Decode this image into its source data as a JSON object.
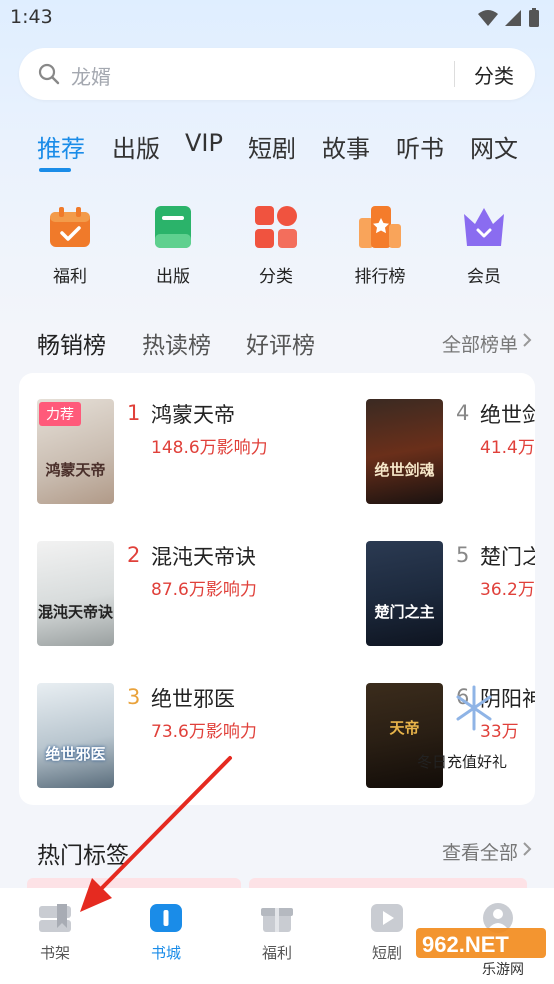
{
  "status": {
    "time": "1:43"
  },
  "search": {
    "placeholder": "龙婿",
    "category_label": "分类"
  },
  "tabs": [
    "推荐",
    "出版",
    "VIP",
    "短剧",
    "故事",
    "听书",
    "网文"
  ],
  "quick_links": [
    {
      "label": "福利",
      "icon": "gift-calendar-icon",
      "color": "#f07a2a"
    },
    {
      "label": "出版",
      "icon": "book-icon",
      "color": "#2bb36a"
    },
    {
      "label": "分类",
      "icon": "category-grid-icon",
      "color": "#f0533f"
    },
    {
      "label": "排行榜",
      "icon": "ranking-icon",
      "color": "#f47c2b"
    },
    {
      "label": "会员",
      "icon": "crown-icon",
      "color": "#8a6cf0"
    }
  ],
  "ranking": {
    "tabs": [
      "畅销榜",
      "热读榜",
      "好评榜"
    ],
    "all_label": "全部榜单",
    "books": [
      {
        "rank": "1",
        "title": "鸿蒙天帝",
        "impact": "148.6万影响力",
        "badge": "力荐",
        "cover_text": "鸿蒙天帝"
      },
      {
        "rank": "2",
        "title": "混沌天帝诀",
        "impact": "87.6万影响力",
        "cover_text": "混沌天帝诀"
      },
      {
        "rank": "3",
        "title": "绝世邪医",
        "impact": "73.6万影响力",
        "cover_text": "绝世邪医"
      },
      {
        "rank": "4",
        "title": "绝世剑",
        "impact": "41.4万",
        "cover_text": "绝世剑魂"
      },
      {
        "rank": "5",
        "title": "楚门之",
        "impact": "36.2万",
        "cover_text": "楚门之主"
      },
      {
        "rank": "6",
        "title": "阴阳神",
        "impact": "33万",
        "cover_text": "天帝"
      }
    ],
    "promo": "冬日充值好礼"
  },
  "hot_tags": {
    "title": "热门标签",
    "all_label": "查看全部"
  },
  "bottom_nav": [
    {
      "label": "书架",
      "icon": "bookshelf-icon"
    },
    {
      "label": "书城",
      "icon": "bookstore-icon"
    },
    {
      "label": "福利",
      "icon": "gift-icon"
    },
    {
      "label": "短剧",
      "icon": "play-video-icon"
    },
    {
      "label": "",
      "icon": "profile-icon"
    }
  ],
  "watermark": {
    "brand": "962.NET",
    "sub": "乐游网"
  },
  "colors": {
    "accent": "#1a8ce8",
    "impact": "#e0403a",
    "rank_top": "#e0403a",
    "rank_third": "#e9a23b"
  }
}
